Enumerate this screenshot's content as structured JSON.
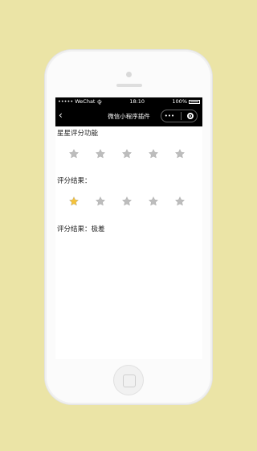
{
  "statusbar": {
    "carrier": "••••• WeChat",
    "wifi": "令",
    "time": "18:10",
    "battery": "100%"
  },
  "navbar": {
    "back_icon": "chevron-left-icon",
    "title": "微信小程序插件",
    "more": "•••"
  },
  "section": {
    "title": "星星评分功能"
  },
  "rating_display": {
    "value": 0,
    "max": 5
  },
  "rating_input": {
    "label": "评分结果：",
    "value": 1,
    "max": 5
  },
  "result": {
    "text": "评分结果：极差"
  },
  "colors": {
    "background": "#ebe4a6",
    "star_empty": "#bdbdbd",
    "star_filled": "#f5c23a"
  }
}
